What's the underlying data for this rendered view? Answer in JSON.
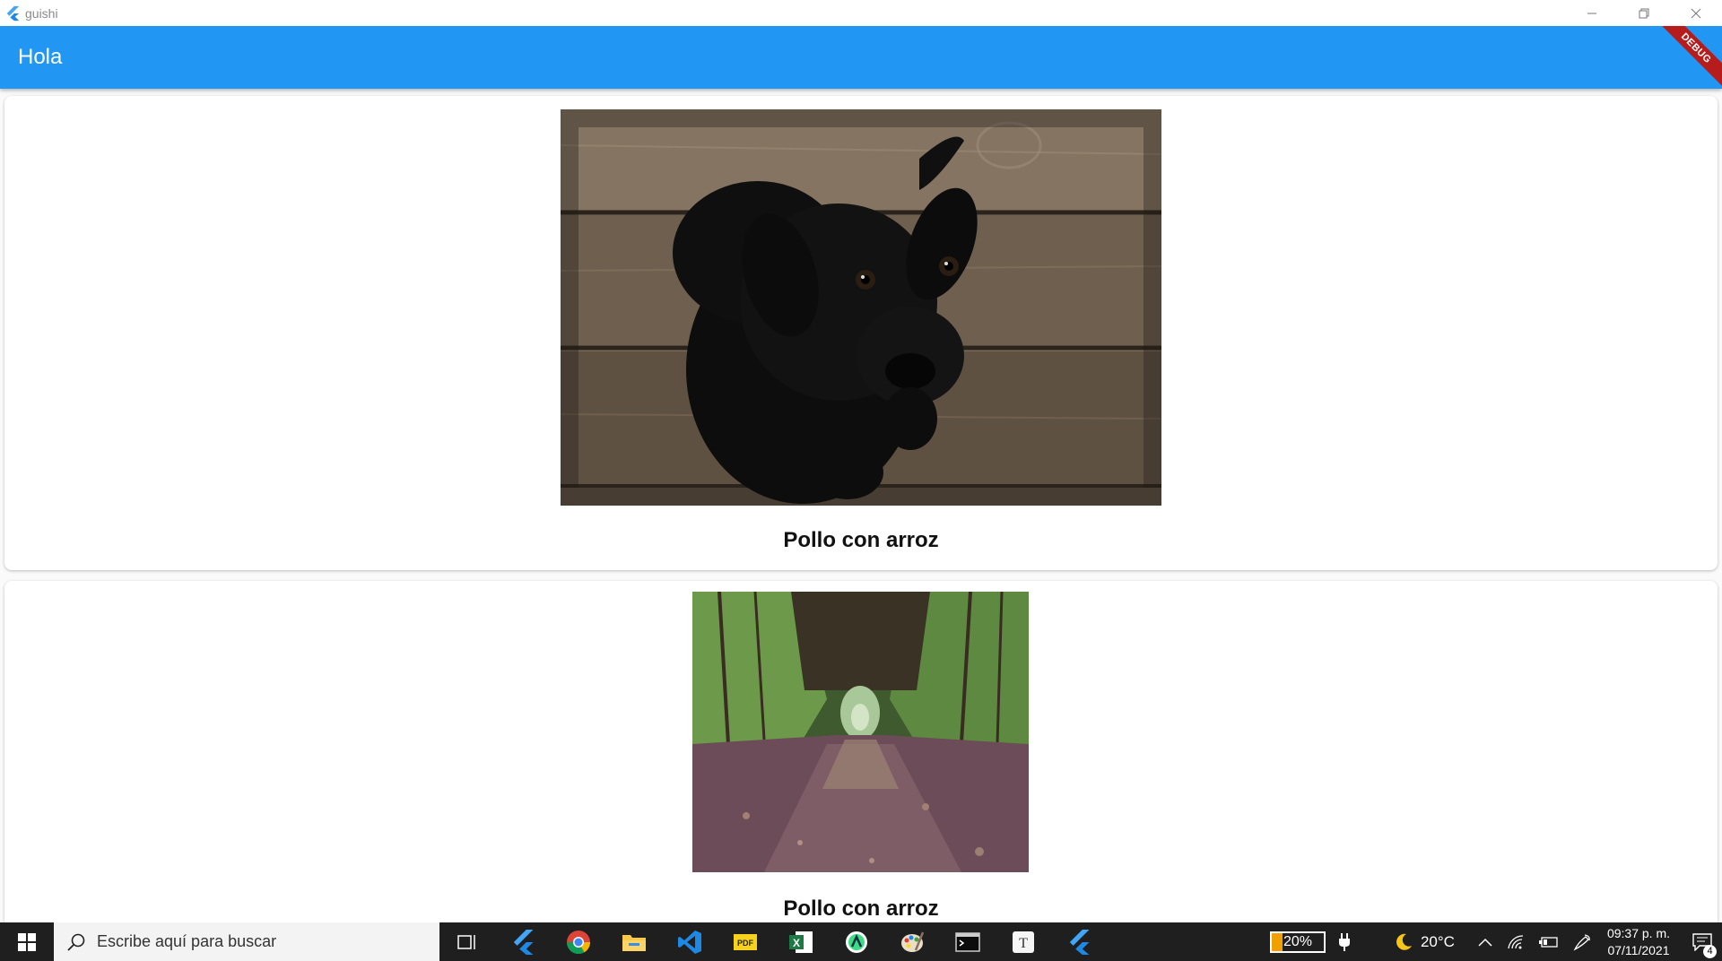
{
  "window": {
    "title": "guishi"
  },
  "appbar": {
    "title": "Hola",
    "debug_banner": "DEBUG",
    "color": "#2196f3"
  },
  "cards": [
    {
      "image": "black-puppy-on-wooden-floor",
      "label": "Pollo con arroz"
    },
    {
      "image": "forest-tunnel-path",
      "label": "Pollo con arroz"
    }
  ],
  "taskbar": {
    "search_placeholder": "Escribe aquí para buscar",
    "apps": [
      "task-view",
      "flutter",
      "chrome",
      "file-explorer",
      "vscode",
      "pdf-reader",
      "excel",
      "android-studio",
      "paint",
      "terminal",
      "typora",
      "flutter"
    ],
    "battery": {
      "level": 0.2,
      "text": "20%"
    },
    "weather": "20°C",
    "time": "09:37 p. m.",
    "date": "07/11/2021",
    "notifications": "4"
  }
}
